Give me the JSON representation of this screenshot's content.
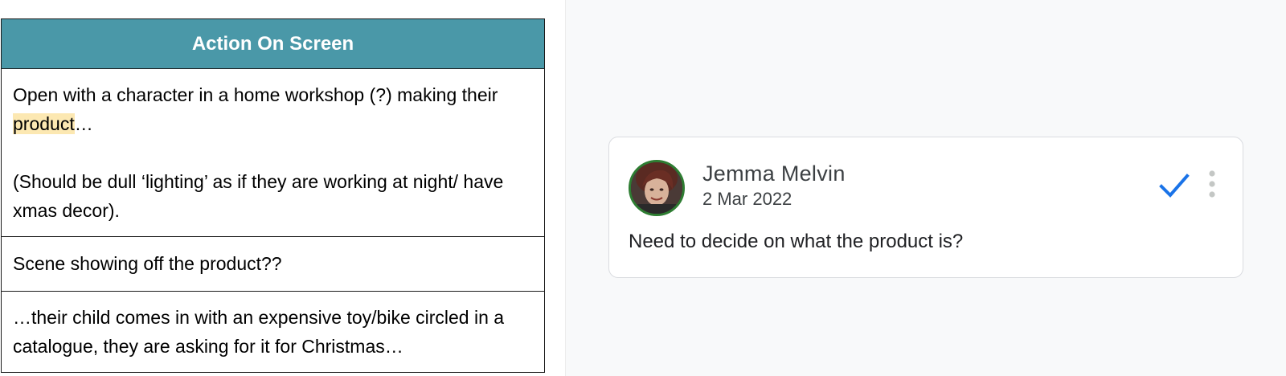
{
  "table": {
    "header": "Action On Screen",
    "rows": [
      {
        "p1_before": "Open with a character in a home workshop (?) making their ",
        "p1_highlight": "product",
        "p1_after": "…",
        "p2": "(Should be dull ‘lighting’ as if they are working at night/ have xmas decor)."
      },
      {
        "text": "Scene showing off the product??"
      },
      {
        "text": "…their child comes in with an expensive toy/bike circled in a catalogue, they are asking for it for Christmas…"
      }
    ]
  },
  "comment": {
    "author": "Jemma Melvin",
    "date": "2 Mar 2022",
    "body": "Need to decide on what the product is?",
    "resolve_icon": "checkmark-icon",
    "more_icon": "more-vertical-icon",
    "accent_color": "#1a73e8",
    "avatar_ring_color": "#2e7d32"
  },
  "highlight_color": "#fce8b2",
  "header_color": "#4a98a8"
}
